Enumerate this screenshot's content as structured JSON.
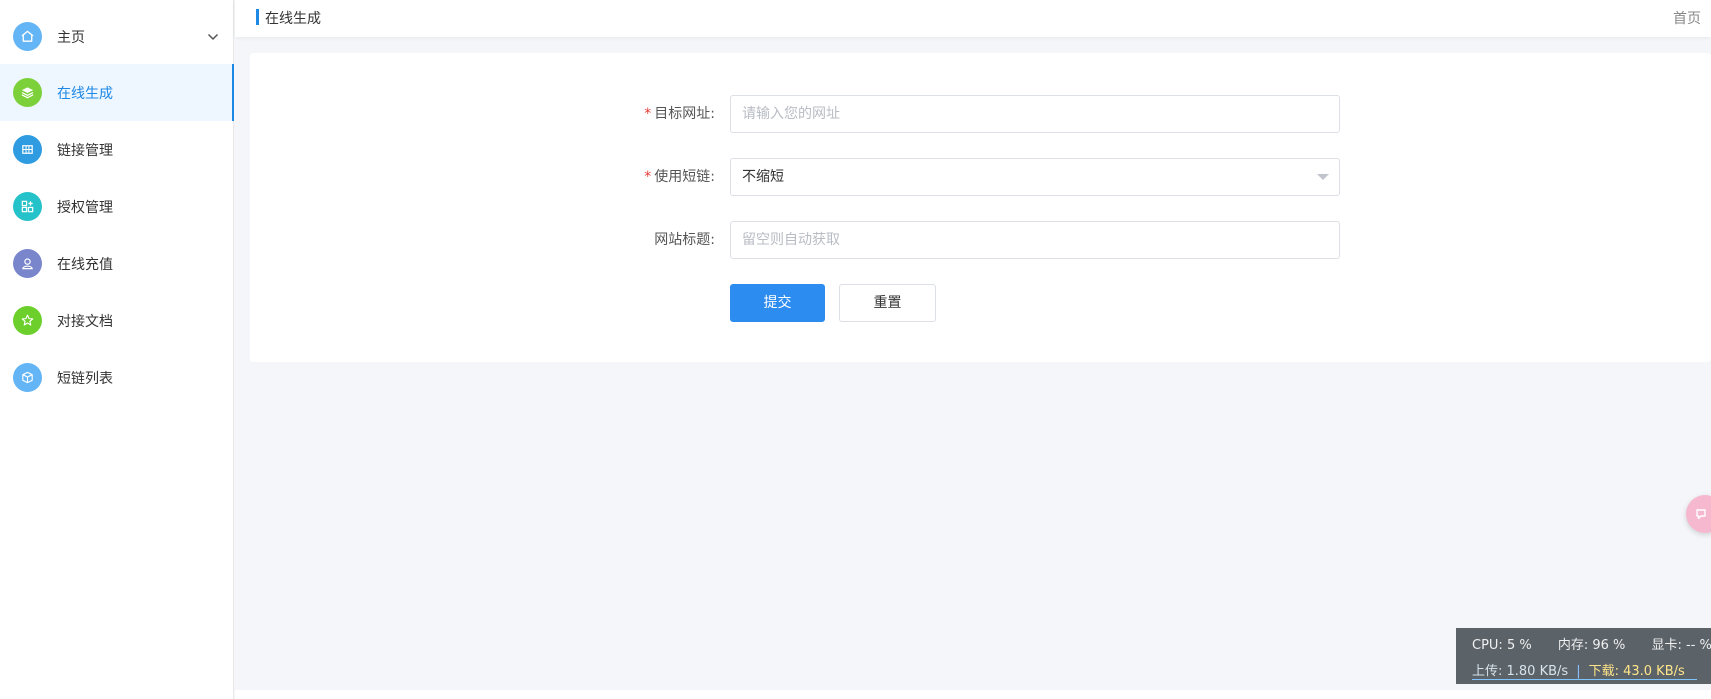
{
  "sidebar": {
    "items": [
      {
        "label": "主页",
        "icon": "home-icon",
        "color": "#64b5f6",
        "has_chevron": true
      },
      {
        "label": "在线生成",
        "icon": "layers-icon",
        "color": "#7cd13b",
        "active": true
      },
      {
        "label": "链接管理",
        "icon": "table-icon",
        "color": "#2f9be0"
      },
      {
        "label": "授权管理",
        "icon": "apps-icon",
        "color": "#25c2c9"
      },
      {
        "label": "在线充值",
        "icon": "user-icon",
        "color": "#7986cb"
      },
      {
        "label": "对接文档",
        "icon": "star-icon",
        "color": "#6ccf2c"
      },
      {
        "label": "短链列表",
        "icon": "cube-icon",
        "color": "#64b5f6"
      }
    ],
    "accent": "#1e88e5"
  },
  "header": {
    "title": "在线生成",
    "home_link": "首页"
  },
  "form": {
    "target_url": {
      "label": "目标网址:",
      "required": true,
      "placeholder": "请输入您的网址",
      "value": ""
    },
    "short_link": {
      "label": "使用短链:",
      "required": true,
      "selected": "不缩短"
    },
    "site_title": {
      "label": "网站标题:",
      "required": false,
      "placeholder": "留空则自动获取",
      "value": ""
    },
    "submit_label": "提交",
    "reset_label": "重置",
    "primary_color": "#2d8cf0"
  },
  "sysmon": {
    "cpu": "CPU: 5 %",
    "memory": "内存: 96 %",
    "gpu": "显卡: -- %",
    "upload": "上传: 1.80 KB/s",
    "download": "下载: 43.0 KB/s"
  }
}
